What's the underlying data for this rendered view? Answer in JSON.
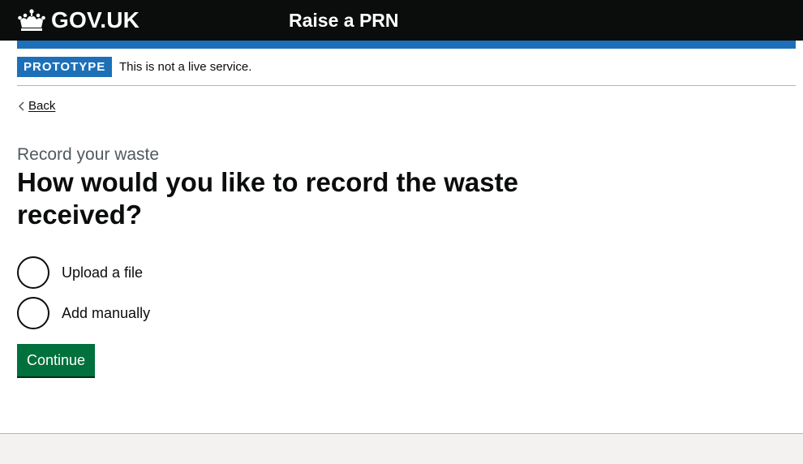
{
  "header": {
    "logo_text": "GOV.UK",
    "service_name": "Raise a PRN",
    "crown_icon": "crown-icon"
  },
  "phase_banner": {
    "tag": "PROTOTYPE",
    "text": "This is not a live service."
  },
  "back_link": {
    "label": "Back",
    "icon": "chevron-left-icon"
  },
  "main": {
    "caption": "Record your waste",
    "heading": "How would you like to record the waste received?",
    "options": [
      {
        "label": "Upload a file",
        "checked": false
      },
      {
        "label": "Add manually",
        "checked": false
      }
    ],
    "button_label": "Continue"
  },
  "colors": {
    "header_bg": "#0b0c0c",
    "brand_blue": "#1d70b8",
    "button_green": "#00703c",
    "secondary_text": "#505a5f",
    "footer_bg": "#f3f2f1"
  }
}
